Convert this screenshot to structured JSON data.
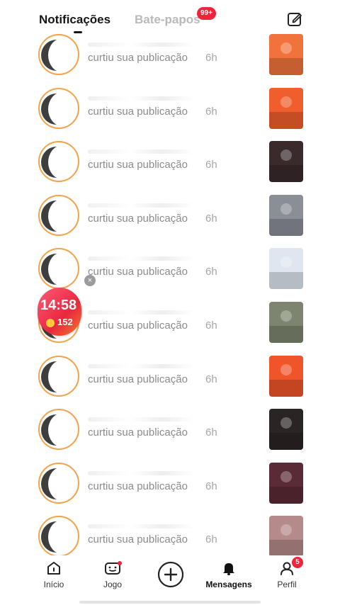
{
  "header": {
    "tab_notifications": "Notificações",
    "tab_chats": "Bate-papos",
    "chats_badge": "99+"
  },
  "notifications": [
    {
      "action": "curtiu sua publicação",
      "time": "6h",
      "thumb_color": "#f1733b"
    },
    {
      "action": "curtiu sua publicação",
      "time": "6h",
      "thumb_color": "#ef5e2c"
    },
    {
      "action": "curtiu sua publicação",
      "time": "6h",
      "thumb_color": "#3a2a2c"
    },
    {
      "action": "curtiu sua publicação",
      "time": "6h",
      "thumb_color": "#8a8f96"
    },
    {
      "action": "curtiu sua publicação",
      "time": "6h",
      "thumb_color": "#dfe6ef"
    },
    {
      "action": "curtiu sua publicação",
      "time": "6h",
      "thumb_color": "#7d8570"
    },
    {
      "action": "curtiu sua publicação",
      "time": "6h",
      "thumb_color": "#f0552a"
    },
    {
      "action": "curtiu sua publicação",
      "time": "6h",
      "thumb_color": "#2b2424"
    },
    {
      "action": "curtiu sua publicação",
      "time": "6h",
      "thumb_color": "#5a2a36"
    },
    {
      "action": "curtiu sua publicação",
      "time": "6h",
      "thumb_color": "#b48a8a"
    }
  ],
  "live": {
    "time": "14:58",
    "coins": "152",
    "close_label": "×"
  },
  "nav": {
    "home": "Início",
    "game": "Jogo",
    "messages": "Mensagens",
    "profile": "Perfil",
    "profile_badge": "5"
  },
  "colors": {
    "accent": "#f0233b",
    "avatar_ring": "#f3a34a",
    "muted_text": "#8b8b8b"
  }
}
